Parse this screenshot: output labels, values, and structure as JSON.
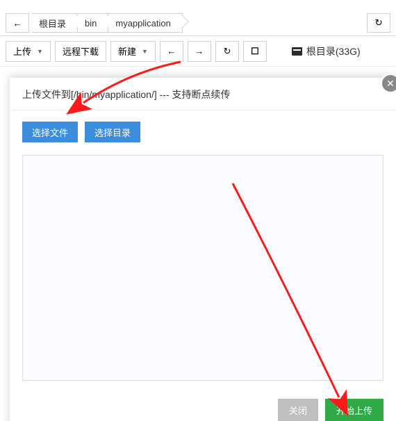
{
  "breadcrumb": {
    "items": [
      "根目录",
      "bin",
      "myapplication"
    ]
  },
  "toolbar": {
    "upload": "上传",
    "remote_download": "远程下载",
    "new": "新建",
    "disk_label": "根目录(33G)"
  },
  "modal": {
    "title": "上传文件到[/bin/myapplication/] --- 支持断点续传",
    "choose_file": "选择文件",
    "choose_dir": "选择目录",
    "close": "关闭",
    "start_upload": "开始上传"
  }
}
